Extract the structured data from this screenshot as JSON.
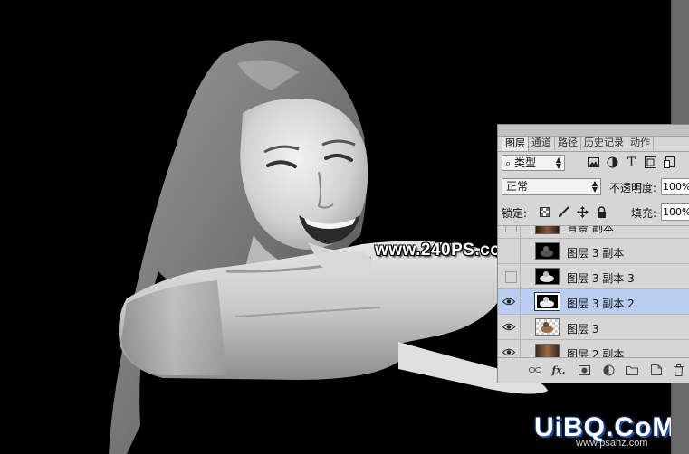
{
  "panel": {
    "tabs": [
      {
        "label": "图层",
        "active": true
      },
      {
        "label": "通道",
        "active": false
      },
      {
        "label": "路径",
        "active": false
      },
      {
        "label": "历史记录",
        "active": false
      },
      {
        "label": "动作",
        "active": false
      }
    ],
    "filter": {
      "icon": "search-icon",
      "value": "类型"
    },
    "filter_icons": [
      "image-filter-icon",
      "adjustment-filter-icon",
      "type-filter-icon",
      "shape-filter-icon",
      "smart-object-filter-icon"
    ],
    "blend_mode": "正常",
    "opacity_label": "不透明度:",
    "opacity_value": "100%",
    "lock_label": "锁定:",
    "lock_icons": [
      "lock-transparency-icon",
      "lock-brush-icon",
      "lock-move-icon",
      "lock-all-icon"
    ],
    "fill_label": "填充:",
    "fill_value": "100%",
    "layers": [
      {
        "name": "背景 副本",
        "visible": false,
        "selected": false,
        "thumb": "thumb-color"
      },
      {
        "name": "图层 3 副本",
        "visible": false,
        "selected": false,
        "thumb": "thumb-dark"
      },
      {
        "name": "图层 3 副本 3",
        "visible": false,
        "selected": false,
        "thumb": "thumb-mask"
      },
      {
        "name": "图层 3 副本 2",
        "visible": true,
        "selected": true,
        "thumb": "thumb-mask"
      },
      {
        "name": "图层 3",
        "visible": true,
        "selected": false,
        "thumb": "thumb-transparent"
      },
      {
        "name": "图层 2 副本",
        "visible": true,
        "selected": false,
        "thumb": "thumb-color"
      }
    ],
    "footer_icons": [
      "link-icon",
      "fx-icon",
      "mask-icon",
      "adjustment-icon",
      "folder-icon",
      "new-layer-icon",
      "trash-icon"
    ]
  },
  "watermarks": {
    "top": "www.240PS.com",
    "logo": "UiBQ.CoM",
    "url": "www.psahz.com"
  },
  "colors": {
    "panel_bg": "#d6d6d6",
    "selected_layer": "#b8cdf0",
    "canvas_bg": "#000000",
    "logo_outline": "#1d4e9a"
  }
}
